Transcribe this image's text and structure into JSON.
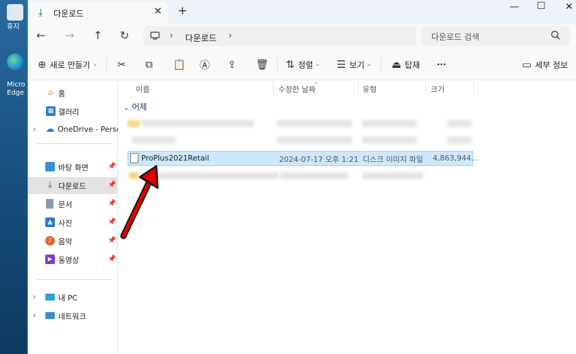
{
  "desktop": {
    "labels": [
      "휴지",
      "Micro",
      "Edge"
    ]
  },
  "tab": {
    "title": "다운로드",
    "close": "✕",
    "new": "+"
  },
  "window_controls": {
    "minimize": "—",
    "maximize": "☐",
    "close": "✕"
  },
  "nav": {
    "back": "←",
    "forward": "→",
    "up": "↑",
    "refresh": "↻"
  },
  "address": {
    "separator": "›",
    "segment": "다운로드"
  },
  "search": {
    "placeholder": "다운로드 검색"
  },
  "toolbar": {
    "new_label": "새로 만들기",
    "sort_label": "정렬",
    "view_label": "보기",
    "mount_label": "탑재",
    "more_label": "···",
    "details_label": "세부 정보"
  },
  "sidebar": {
    "home": "홈",
    "gallery": "갤러리",
    "onedrive": "OneDrive - Person",
    "desktop": "바탕 화면",
    "downloads": "다운로드",
    "documents": "문서",
    "pictures": "사진",
    "music": "음악",
    "videos": "동영상",
    "thispc": "내 PC",
    "network": "네트워크"
  },
  "columns": {
    "name": "이름",
    "modified": "수정한 날짜",
    "type": "유형",
    "size": "크기"
  },
  "group": {
    "label": "어제"
  },
  "files": [
    {
      "name": "ProPlus2021Retail",
      "modified": "2024-07-17 오후 1:21",
      "type": "디스크 이미지 파일",
      "size": "4,863,944..."
    }
  ],
  "colors": {
    "selection": "#cce8ff",
    "accent": "#0a7c2f",
    "annotation": "#e00000"
  }
}
